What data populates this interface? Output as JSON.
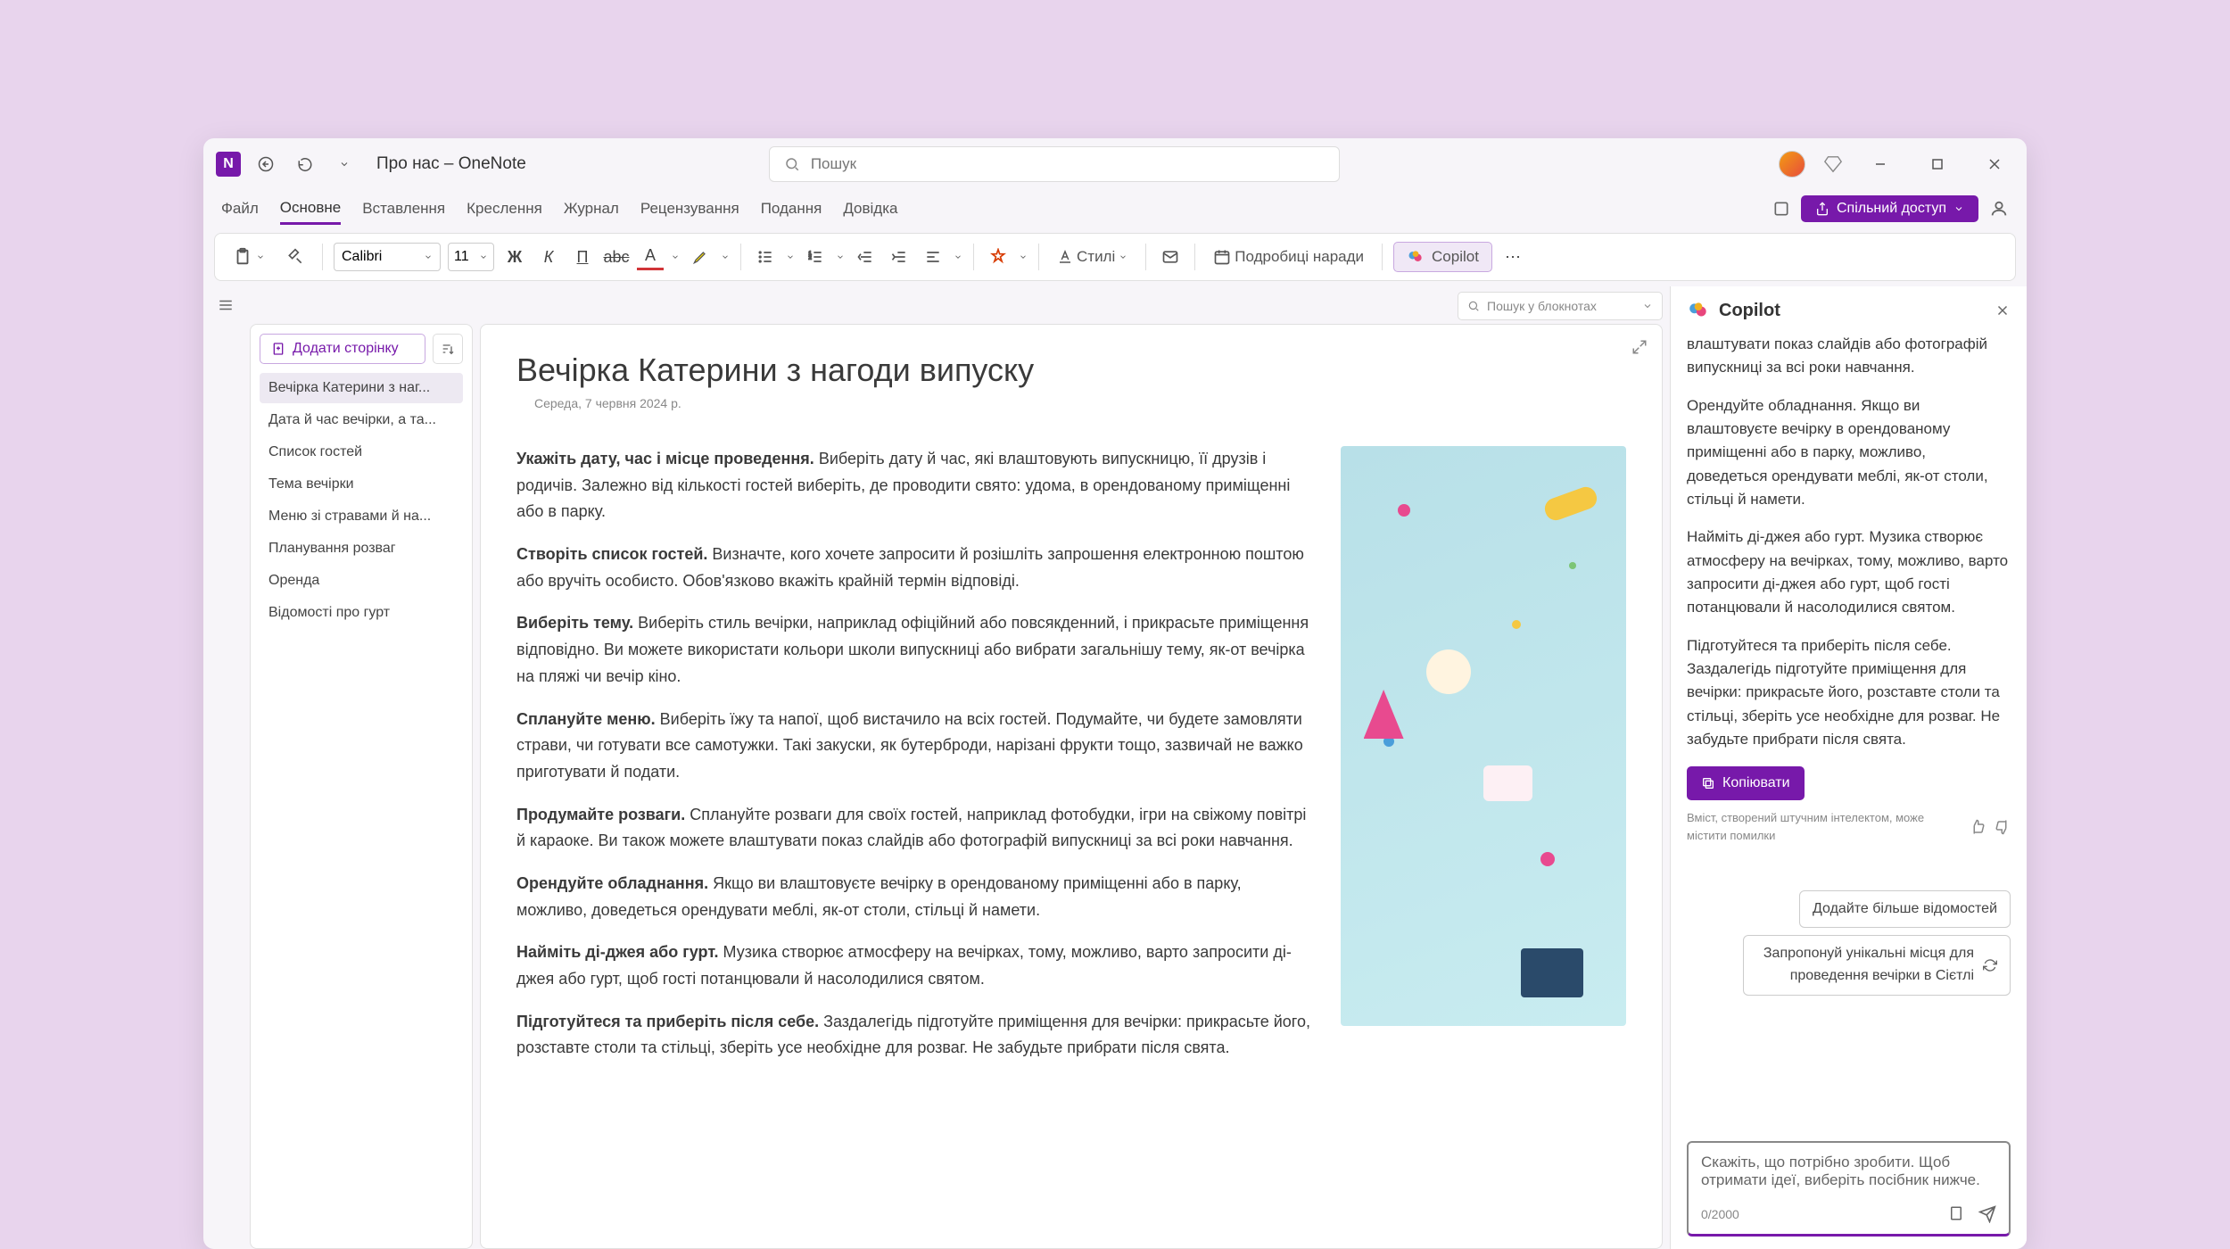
{
  "titlebar": {
    "title": "Про нас – OneNote",
    "search_placeholder": "Пошук"
  },
  "tabs": {
    "items": [
      "Файл",
      "Основне",
      "Вставлення",
      "Креслення",
      "Журнал",
      "Рецензування",
      "Подання",
      "Довідка"
    ],
    "active_index": 1,
    "share_label": "Спільний доступ"
  },
  "ribbon": {
    "font": "Calibri",
    "size": "11",
    "styles_label": "Стилі",
    "meeting_label": "Подробиці наради",
    "copilot_label": "Copilot"
  },
  "search_notebooks": "Пошук у блокнотах",
  "sidebar": {
    "add_page": "Додати сторінку",
    "pages": [
      "Вечірка Катерини з наг...",
      "Дата й час вечірки, а та...",
      "Список гостей",
      "Тема вечірки",
      "Меню зі стравами й на...",
      "Планування розваг",
      "Оренда",
      "Відомості про гурт"
    ],
    "active_index": 0
  },
  "note": {
    "title": "Вечірка Катерини з нагоди випуску",
    "date": "Середа, 7 червня 2024 р.",
    "paragraphs": [
      {
        "bold": "Укажіть дату, час і місце проведення.",
        "text": " Виберіть дату й час, які влаштовують випускницю, її друзів і родичів. Залежно від кількості гостей виберіть, де проводити свято: удома, в орендованому приміщенні або в парку."
      },
      {
        "bold": "Створіть список гостей.",
        "text": " Визначте, кого хочете запросити й розішліть запрошення електронною поштою або вручіть особисто. Обов'язково вкажіть крайній термін відповіді."
      },
      {
        "bold": "Виберіть тему.",
        "text": " Виберіть стиль вечірки, наприклад офіційний або повсякденний, і прикрасьте приміщення відповідно. Ви можете використати кольори школи випускниці або вибрати загальнішу тему, як-от вечірка на пляжі чи вечір кіно."
      },
      {
        "bold": "Сплануйте меню.",
        "text": " Виберіть їжу та напої, щоб вистачило на всіх гостей. Подумайте, чи будете замовляти страви, чи готувати все самотужки. Такі закуски, як бутерброди, нарізані фрукти тощо, зазвичай не важко приготувати й подати."
      },
      {
        "bold": "Продумайте розваги.",
        "text": " Сплануйте розваги для своїх гостей, наприклад фотобудки, ігри на свіжому повітрі й караоке. Ви також можете влаштувати показ слайдів або фотографій випускниці за всі роки навчання."
      },
      {
        "bold": "Орендуйте обладнання.",
        "text": " Якщо ви влаштовуєте вечірку в орендованому приміщенні або в парку, можливо, доведеться орендувати меблі, як-от столи, стільці й намети."
      },
      {
        "bold": "Найміть ді-джея або гурт.",
        "text": " Музика створює атмосферу на вечірках, тому, можливо, варто запросити ді-джея або гурт, щоб гості потанцювали й насолодилися святом."
      },
      {
        "bold": "Підготуйтеся та приберіть після себе.",
        "text": " Заздалегідь підготуйте приміщення для вечірки: прикрасьте його, розставте столи та стільці, зберіть усе необхідне для розваг. Не забудьте прибрати після свята."
      }
    ]
  },
  "copilot": {
    "title": "Copilot",
    "messages": [
      "влаштувати показ слайдів або фотографій випускниці за всі роки навчання.",
      "Орендуйте обладнання. Якщо ви влаштовуєте вечірку в орендованому приміщенні або в парку, можливо, доведеться орендувати меблі, як-от столи, стільці й намети.",
      "Найміть ді-джея або гурт. Музика створює атмосферу на вечірках, тому, можливо, варто запросити ді-джея або гурт, щоб гості потанцювали й насолодилися святом.",
      "Підготуйтеся та приберіть після себе. Заздалегідь підготуйте приміщення для вечірки: прикрасьте його, розставте столи та стільці, зберіть усе необхідне для розваг. Не забудьте прибрати після свята."
    ],
    "copy_label": "Копіювати",
    "disclaimer": "Вміст, створений штучним інтелектом, може містити помилки",
    "suggestions": [
      "Додайте більше відомостей",
      "Запропонуй унікальні місця для проведення вечірки в Сієтлі"
    ],
    "input_placeholder": "Скажіть, що потрібно зробити. Щоб отримати ідеї, виберіть посібник нижче.",
    "char_count": "0/2000"
  }
}
